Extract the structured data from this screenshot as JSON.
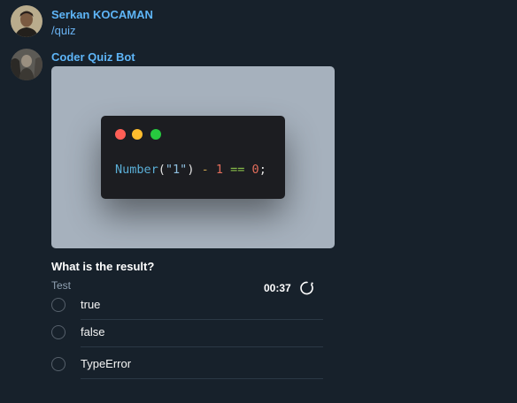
{
  "messages": [
    {
      "sender": "Serkan KOCAMAN",
      "text": "/quiz",
      "avatar_icon": "user-avatar"
    },
    {
      "sender": "Coder Quiz Bot",
      "avatar_icon": "bot-avatar"
    }
  ],
  "code_image": {
    "window_buttons": [
      "close-dot",
      "minimize-dot",
      "maximize-dot"
    ],
    "tokens": [
      {
        "text": "Number",
        "color": "#5aaed6"
      },
      {
        "text": "(",
        "color": "#e4e4e4"
      },
      {
        "text": "\"1\"",
        "color": "#8ebfdf"
      },
      {
        "text": ") ",
        "color": "#e4e4e4"
      },
      {
        "text": "-",
        "color": "#c7a24d"
      },
      {
        "text": " ",
        "color": "#e4e4e4"
      },
      {
        "text": "1",
        "color": "#e06c5a"
      },
      {
        "text": " ",
        "color": "#e4e4e4"
      },
      {
        "text": "==",
        "color": "#8bc34a"
      },
      {
        "text": " ",
        "color": "#e4e4e4"
      },
      {
        "text": "0",
        "color": "#e06c5a"
      },
      {
        "text": ";",
        "color": "#e4e4e4"
      }
    ]
  },
  "quiz": {
    "question": "What is the result?",
    "type_label": "Test",
    "timer": "00:37",
    "options": [
      "true",
      "false",
      "TypeError"
    ]
  },
  "colors": {
    "background": "#17212b",
    "sender_name": "#5eb5f7",
    "dot_red": "#ff5f56",
    "dot_yellow": "#ffbd2e",
    "dot_green": "#27c93f"
  }
}
